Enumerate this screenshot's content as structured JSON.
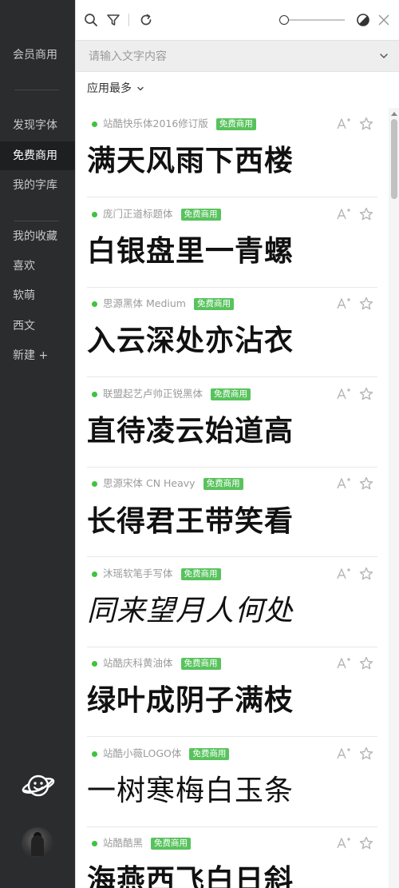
{
  "sidebar": {
    "commercial": "会员商用",
    "discover": "发现字体",
    "free": "免费商用",
    "library": "我的字库",
    "collections": "我的收藏",
    "like": "喜欢",
    "soft": "软萌",
    "western": "西文",
    "new": "新建 +",
    "active_item": "免费商用"
  },
  "toolbar": {
    "icons": [
      "search-icon",
      "filter-icon",
      "refresh-icon",
      "size-slider",
      "theme-toggle-icon",
      "close-icon"
    ],
    "slider_value": 0
  },
  "search": {
    "placeholder": "请输入文字内容",
    "value": ""
  },
  "sort": {
    "label": "应用最多"
  },
  "fonts": [
    {
      "name": "站酷快乐体2016修订版",
      "badge": "免费商用",
      "preview": "满天风雨下西楼"
    },
    {
      "name": "庞门正道标题体",
      "badge": "免费商用",
      "preview": "白银盘里一青螺"
    },
    {
      "name": "思源黑体 Medium",
      "badge": "免费商用",
      "preview": "入云深处亦沾衣"
    },
    {
      "name": "联盟起艺卢帅正锐黑体",
      "badge": "免费商用",
      "preview": "直待凌云始道高"
    },
    {
      "name": "思源宋体 CN Heavy",
      "badge": "免费商用",
      "preview": "长得君王带笑看"
    },
    {
      "name": "沐瑶软笔手写体",
      "badge": "免费商用",
      "preview": "同来望月人何处"
    },
    {
      "name": "站酷庆科黄油体",
      "badge": "免费商用",
      "preview": "绿叶成阴子满枝"
    },
    {
      "name": "站酷小薇LOGO体",
      "badge": "免费商用",
      "preview": "一树寒梅白玉条"
    },
    {
      "name": "站酷酷黑",
      "badge": "免费商用",
      "preview": "海燕西飞白日斜"
    }
  ],
  "colors": {
    "sidebar_bg": "#2b2c2e",
    "active_bg": "#1e1f21",
    "badge": "#58c35d",
    "dot": "#3ec33e"
  }
}
